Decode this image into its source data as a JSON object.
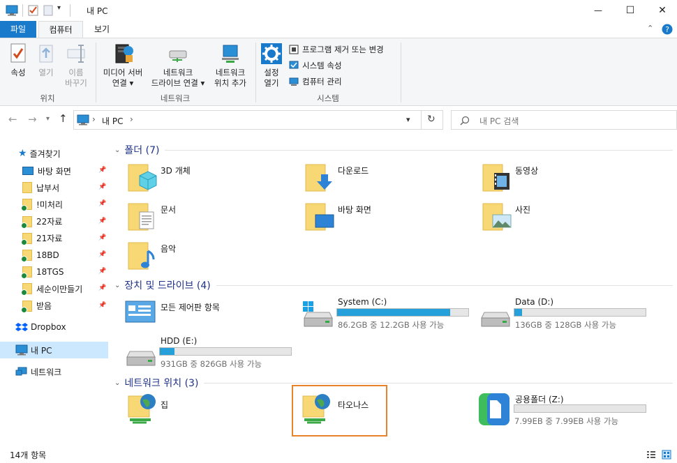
{
  "window": {
    "title": "내 PC",
    "controls": {
      "minimize": "—",
      "maximize": "☐",
      "close": "✕"
    }
  },
  "ribbon": {
    "tabs": [
      "파일",
      "컴퓨터",
      "보기"
    ],
    "groups": {
      "location": {
        "label": "위치",
        "buttons": [
          {
            "l1": "속성",
            "l2": ""
          },
          {
            "l1": "열기",
            "l2": ""
          },
          {
            "l1": "이름",
            "l2": "바꾸기"
          }
        ]
      },
      "network": {
        "label": "네트워크",
        "buttons": [
          {
            "l1": "미디어 서버",
            "l2": "연결 ▾"
          },
          {
            "l1": "네트워크",
            "l2": "드라이브 연결 ▾"
          },
          {
            "l1": "네트워크",
            "l2": "위치 추가"
          }
        ]
      },
      "system": {
        "label": "시스템",
        "big_button": {
          "l1": "설정",
          "l2": "열기"
        },
        "small_buttons": [
          "프로그램 제거 또는 변경",
          "시스템 속성",
          "컴퓨터 관리"
        ]
      }
    }
  },
  "address": {
    "crumb": "내 PC",
    "search_placeholder": "내 PC 검색"
  },
  "sidebar": {
    "quick_access": "즐겨찾기",
    "items": [
      {
        "label": "바탕 화면",
        "icon": "desktop",
        "sync": false
      },
      {
        "label": "납부서",
        "icon": "folder",
        "sync": false
      },
      {
        "label": "!미처리",
        "icon": "folder",
        "sync": true
      },
      {
        "label": "22자료",
        "icon": "folder",
        "sync": true
      },
      {
        "label": "21자료",
        "icon": "folder",
        "sync": true
      },
      {
        "label": "18BD",
        "icon": "folder",
        "sync": true
      },
      {
        "label": "18TGS",
        "icon": "folder",
        "sync": true
      },
      {
        "label": "세순이만들기",
        "icon": "folder",
        "sync": true
      },
      {
        "label": "받음",
        "icon": "folder",
        "sync": true
      }
    ],
    "dropbox": "Dropbox",
    "this_pc": "내 PC",
    "network": "네트워크"
  },
  "main": {
    "folders": {
      "header": "폴더 (7)",
      "items": [
        "3D 개체",
        "다운로드",
        "동영상",
        "문서",
        "바탕 화면",
        "사진",
        "음악"
      ]
    },
    "drives": {
      "header": "장치 및 드라이브 (4)",
      "control_panel": "모든 제어판 항목",
      "items": [
        {
          "name": "System (C:)",
          "free": "86.2GB 중 12.2GB 사용 가능",
          "used_fraction": 0.86
        },
        {
          "name": "Data (D:)",
          "free": "136GB 중 128GB 사용 가능",
          "used_fraction": 0.06
        },
        {
          "name": "HDD (E:)",
          "free": "931GB 중 826GB 사용 가능",
          "used_fraction": 0.11
        }
      ]
    },
    "network_locations": {
      "header": "네트워크 위치 (3)",
      "items": [
        {
          "name": "집"
        },
        {
          "name": "타오나스"
        },
        {
          "name": "공용폴더 (Z:)",
          "free": "7.99EB 중 7.99EB 사용 가능",
          "used_fraction": 0.0
        }
      ]
    }
  },
  "status": {
    "count": "14개 항목"
  },
  "colors": {
    "accent": "#1979ca",
    "bar": "#26a0da",
    "highlight": "#e8832a",
    "selection": "#cce8ff"
  }
}
